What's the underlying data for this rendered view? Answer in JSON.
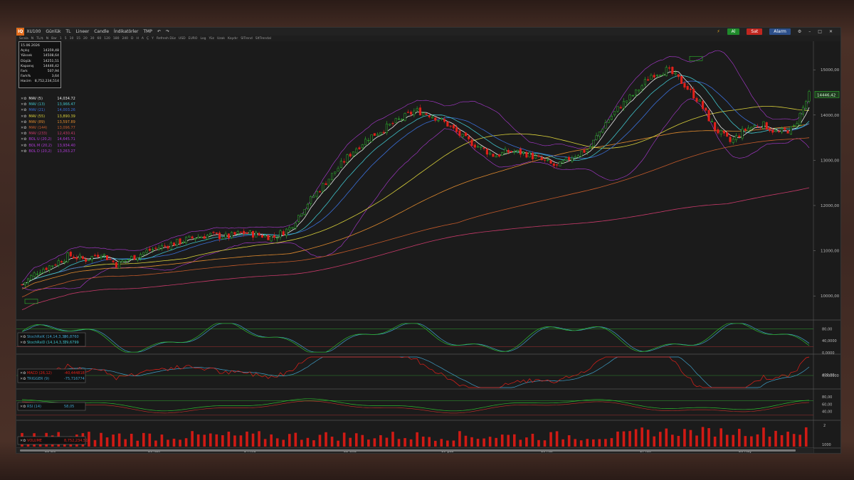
{
  "app": {
    "symbol": "XU100",
    "toolbar": [
      "Günlük",
      "TL",
      "Lineer",
      "Candle",
      "İndikatörler",
      "TMP"
    ],
    "subbar": [
      "Sırala",
      "N",
      "TL/$",
      "N",
      "Bar",
      "1",
      "5",
      "10",
      "15",
      "20",
      "30",
      "60",
      "120",
      "180",
      "240",
      "D",
      "H",
      "A",
      "Ç",
      "Y",
      "Refresh Düz",
      "USD",
      "EURO",
      "Log",
      "Yüz",
      "Uzak",
      "Kaydır",
      "SITrend",
      "SItTrendal"
    ],
    "buttons": {
      "al": "Al",
      "sat": "Sat",
      "alarm": "Alarm"
    }
  },
  "info": {
    "date": "15.06.2026",
    "rows": [
      {
        "label": "Açılış",
        "value": "14359,48"
      },
      {
        "label": "Yüksek",
        "value": "14508,64"
      },
      {
        "label": "Düşük",
        "value": "14251,51"
      },
      {
        "label": "Kapanış",
        "value": "14446,42"
      },
      {
        "label": "Fark",
        "value": "507,94"
      },
      {
        "label": "Fark%",
        "value": "3,64"
      },
      {
        "label": "Hacim",
        "value": "8,752,234,514"
      }
    ]
  },
  "indicators": [
    {
      "label": "MAV (5)",
      "value": "14,034.72",
      "color": "#e8e8e8"
    },
    {
      "label": "MAV (13)",
      "value": "13,966.47",
      "color": "#3fc1c9"
    },
    {
      "label": "MAV (21)",
      "value": "14,003.26",
      "color": "#3a6fd8"
    },
    {
      "label": "MAV (55)",
      "value": "13,890.39",
      "color": "#d9d03a"
    },
    {
      "label": "MAV (89)",
      "value": "13,597.89",
      "color": "#e08a2e"
    },
    {
      "label": "MAV (144)",
      "value": "13,096.77",
      "color": "#c45a2a"
    },
    {
      "label": "MAV (233)",
      "value": "12,430.41",
      "color": "#c93a6a"
    },
    {
      "label": "BOL U (20,2)",
      "value": "14,645.71",
      "color": "#b03ad8"
    },
    {
      "label": "BOL M (20,2)",
      "value": "13,934.40",
      "color": "#b03ad8"
    },
    {
      "label": "BOL D (20,2)",
      "value": "13,263.27",
      "color": "#b03ad8"
    }
  ],
  "price_axis": {
    "ticks": [
      "15000,00",
      "14000,00",
      "13000,00",
      "12000,00",
      "11000,00",
      "10000,00"
    ],
    "last": "14446,42",
    "high_label": "15000,00",
    "low_label": "10000,00"
  },
  "stoch": {
    "k": {
      "label": "StochRsiK (14,14,3,3)",
      "value": "86,8760"
    },
    "d": {
      "label": "StochRsiD (14,14,3,3)",
      "value": "79,6799"
    },
    "ticks": [
      "80,00",
      "40,0000",
      "0,0000"
    ]
  },
  "macd": {
    "macd": {
      "label": "MACD (26,12)",
      "value": "-40,444818"
    },
    "trigger": {
      "label": "TRIGGER (9)",
      "value": "-75,716774"
    },
    "ticks": [
      "400,00",
      "0,000000"
    ]
  },
  "rsi": {
    "label": "RSI (14)",
    "value": "58,05",
    "ticks": [
      "80,00",
      "60,00",
      "40,00"
    ]
  },
  "volume": {
    "label": "VOLUME",
    "value": "8,752,234,514",
    "ticks": [
      "2",
      "1000"
    ]
  },
  "dates": [
    "28 Eki",
    "26 Kas",
    "24 Ara",
    "22 Oca",
    "19 Şub",
    "19 Mar",
    "17 Nis",
    "20 May"
  ],
  "chart_data": {
    "type": "candlestick",
    "y_range": [
      9500,
      15600
    ],
    "closes_sample": [
      10250,
      10550,
      10700,
      10900,
      10800,
      10950,
      10700,
      10850,
      11000,
      11100,
      11200,
      11300,
      11350,
      11300,
      11400,
      11350,
      11300,
      11500,
      12000,
      12400,
      12800,
      13200,
      13500,
      13700,
      13900,
      14100,
      14000,
      13800,
      13500,
      13300,
      13100,
      13200,
      13150,
      13000,
      12850,
      13100,
      13250,
      13800,
      14200,
      14500,
      14900,
      15000,
      14700,
      14300,
      13700,
      13400,
      13700,
      13800,
      13600,
      13700,
      14446
    ]
  }
}
